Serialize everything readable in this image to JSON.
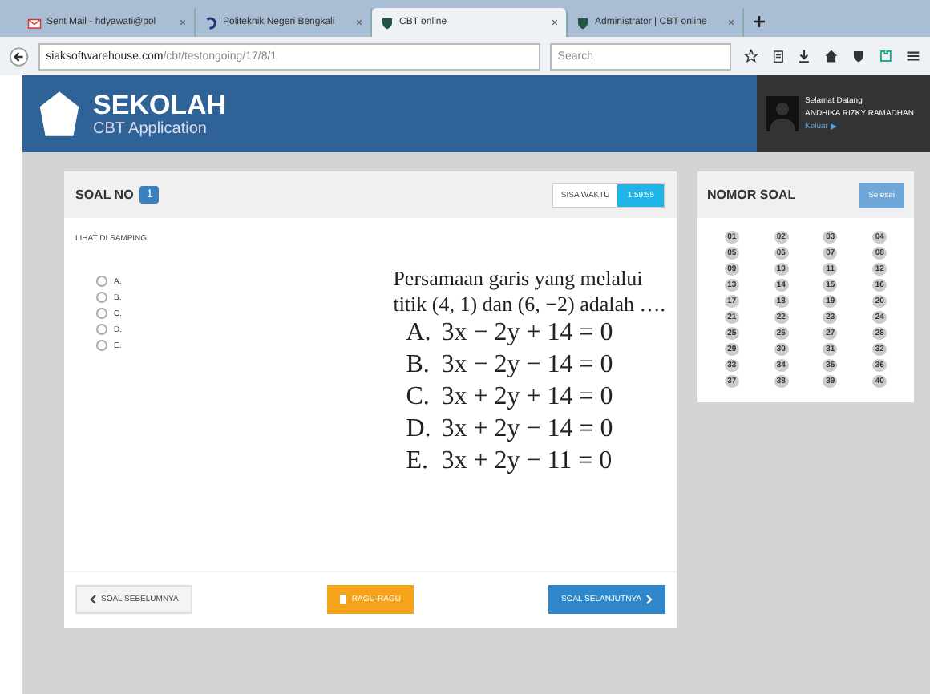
{
  "browser": {
    "tabs": [
      {
        "title": "Sent Mail - hdyawati@pol",
        "selected": false,
        "kind": "mail"
      },
      {
        "title": "Politeknik Negeri Bengkali",
        "selected": false,
        "kind": "swirl"
      },
      {
        "title": "CBT online",
        "selected": true,
        "kind": "shield"
      },
      {
        "title": "Administrator | CBT online",
        "selected": false,
        "kind": "shield"
      }
    ],
    "address": {
      "host": "siaksoftwarehouse.com",
      "path": "/cbt/testongoing/17/8/1"
    },
    "search": {
      "placeholder": "Search"
    }
  },
  "header": {
    "brand": "SEKOLAH",
    "subtitle": "CBT Application",
    "greeting": "Selamat Datang",
    "user": "ANDHIKA RIZKY RAMADHAN",
    "logout": "Keluar"
  },
  "question_panel": {
    "title": "SOAL NO",
    "number": "1",
    "time_label": "SISA WAKTU",
    "time": "1:59:55",
    "instruction": "LIHAT DI SAMPING",
    "options": [
      {
        "label": "A.",
        "selected": false
      },
      {
        "label": "B.",
        "selected": false
      },
      {
        "label": "C.",
        "selected": false
      },
      {
        "label": "D.",
        "selected": false
      },
      {
        "label": "E.",
        "selected": false
      }
    ],
    "question": {
      "stem": [
        "Persamaan garis yang melalui",
        "titik (4, 1) dan (6, −2) adalah …."
      ],
      "choices": [
        {
          "letter": "A.",
          "text": "3x − 2y + 14 = 0"
        },
        {
          "letter": "B.",
          "text": "3x − 2y − 14 = 0"
        },
        {
          "letter": "C.",
          "text": "3x + 2y + 14 = 0"
        },
        {
          "letter": "D.",
          "text": "3x + 2y − 14 = 0"
        },
        {
          "letter": "E.",
          "text": "3x + 2y − 11 = 0"
        }
      ]
    },
    "prev": "SOAL SEBELUMNYA",
    "doubt": "RAGU-RAGU",
    "next": "SOAL SELANJUTNYA"
  },
  "number_panel": {
    "title": "NOMOR SOAL",
    "finish": "Selesai",
    "numbers": [
      "01",
      "02",
      "03",
      "04",
      "05",
      "06",
      "07",
      "08",
      "09",
      "10",
      "11",
      "12",
      "13",
      "14",
      "15",
      "16",
      "17",
      "18",
      "19",
      "20",
      "21",
      "22",
      "23",
      "24",
      "25",
      "26",
      "27",
      "28",
      "29",
      "30",
      "31",
      "32",
      "33",
      "34",
      "35",
      "36",
      "37",
      "38",
      "39",
      "40"
    ]
  }
}
